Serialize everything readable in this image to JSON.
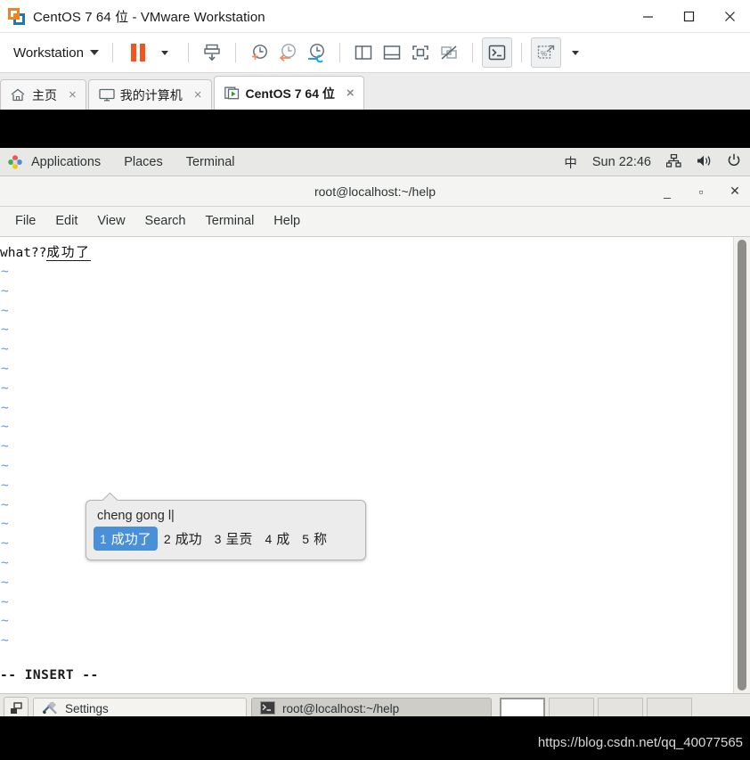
{
  "window": {
    "title": "CentOS 7 64 位 - VMware Workstation",
    "logo_icon": "vmware-logo-icon",
    "controls": [
      {
        "name": "minimize-button",
        "icon": "minimize-icon"
      },
      {
        "name": "maximize-button",
        "icon": "maximize-icon"
      },
      {
        "name": "close-button",
        "icon": "close-icon"
      }
    ]
  },
  "toolbar": {
    "menu_label": "Workstation",
    "menu_caret_icon": "chevron-down-icon",
    "buttons": [
      {
        "name": "suspend-button",
        "icon": "pause-icon"
      },
      {
        "name": "suspend-dropdown",
        "icon": "chevron-down-icon"
      },
      {
        "name": "snapshot-button",
        "icon": "snapshot-icon"
      },
      {
        "name": "take-snapshot-button",
        "icon": "clock-plus-icon"
      },
      {
        "name": "revert-snapshot-button",
        "icon": "clock-back-icon"
      },
      {
        "name": "snapshot-manager-button",
        "icon": "clock-wrench-icon"
      },
      {
        "name": "show-sidebar-button",
        "icon": "panel-left-icon"
      },
      {
        "name": "show-bottom-panel-button",
        "icon": "panel-bottom-icon"
      },
      {
        "name": "fullscreen-button",
        "icon": "fullscreen-icon"
      },
      {
        "name": "unity-mode-button",
        "icon": "unity-off-icon"
      },
      {
        "name": "console-button",
        "icon": "terminal-icon"
      },
      {
        "name": "stretch-guest-button",
        "icon": "stretch-icon"
      },
      {
        "name": "stretch-dropdown",
        "icon": "chevron-down-icon"
      }
    ]
  },
  "tabs": [
    {
      "label": "主页",
      "icon": "home-icon",
      "active": false,
      "close_icon": "×"
    },
    {
      "label": "我的计算机",
      "icon": "monitor-icon",
      "active": false,
      "close_icon": "×"
    },
    {
      "label": "CentOS 7 64 位",
      "icon": "vm-running-icon",
      "active": true,
      "close_icon": "×"
    }
  ],
  "gnome_panel": {
    "activities_icon": "fedora-icon",
    "left_items": [
      "Applications",
      "Places",
      "Terminal"
    ],
    "input_method": "中",
    "clock": "Sun 22:46",
    "tray": [
      {
        "name": "network-icon",
        "icon": "network-icon"
      },
      {
        "name": "volume-icon",
        "icon": "speaker-icon"
      },
      {
        "name": "power-icon",
        "icon": "power-icon"
      }
    ]
  },
  "terminal": {
    "title": "root@localhost:~/help",
    "window_buttons": [
      {
        "name": "terminal-minimize-button",
        "glyph": "_"
      },
      {
        "name": "terminal-maximize-button",
        "glyph": "▫"
      },
      {
        "name": "terminal-close-button",
        "glyph": "✕"
      }
    ],
    "menus": [
      "File",
      "Edit",
      "View",
      "Search",
      "Terminal",
      "Help"
    ],
    "line_ascii": "what??",
    "line_preedit": "成功了",
    "tilde": "~",
    "tilde_count": 20,
    "status_line": "-- INSERT --"
  },
  "ime_popup": {
    "preedit": "cheng gong l|",
    "candidates": [
      {
        "num": "1",
        "text": "成功了",
        "selected": true
      },
      {
        "num": "2",
        "text": "成功",
        "selected": false
      },
      {
        "num": "3",
        "text": "呈贡",
        "selected": false
      },
      {
        "num": "4",
        "text": "成",
        "selected": false
      },
      {
        "num": "5",
        "text": "称",
        "selected": false
      }
    ],
    "highlight_color": "#4a90d9"
  },
  "taskbar": {
    "show_desktop_icon": "show-desktop-icon",
    "windows": [
      {
        "label": "Settings",
        "icon": "tools-icon",
        "active": false
      },
      {
        "label": "root@localhost:~/help",
        "icon": "terminal-icon",
        "active": true
      }
    ],
    "workspaces": [
      {
        "name": "workspace-1",
        "active": true
      },
      {
        "name": "workspace-2",
        "active": false
      },
      {
        "name": "workspace-3",
        "active": false
      },
      {
        "name": "workspace-4",
        "active": false
      }
    ]
  },
  "watermark": {
    "text": "https://blog.csdn.net/qq_40077565"
  }
}
